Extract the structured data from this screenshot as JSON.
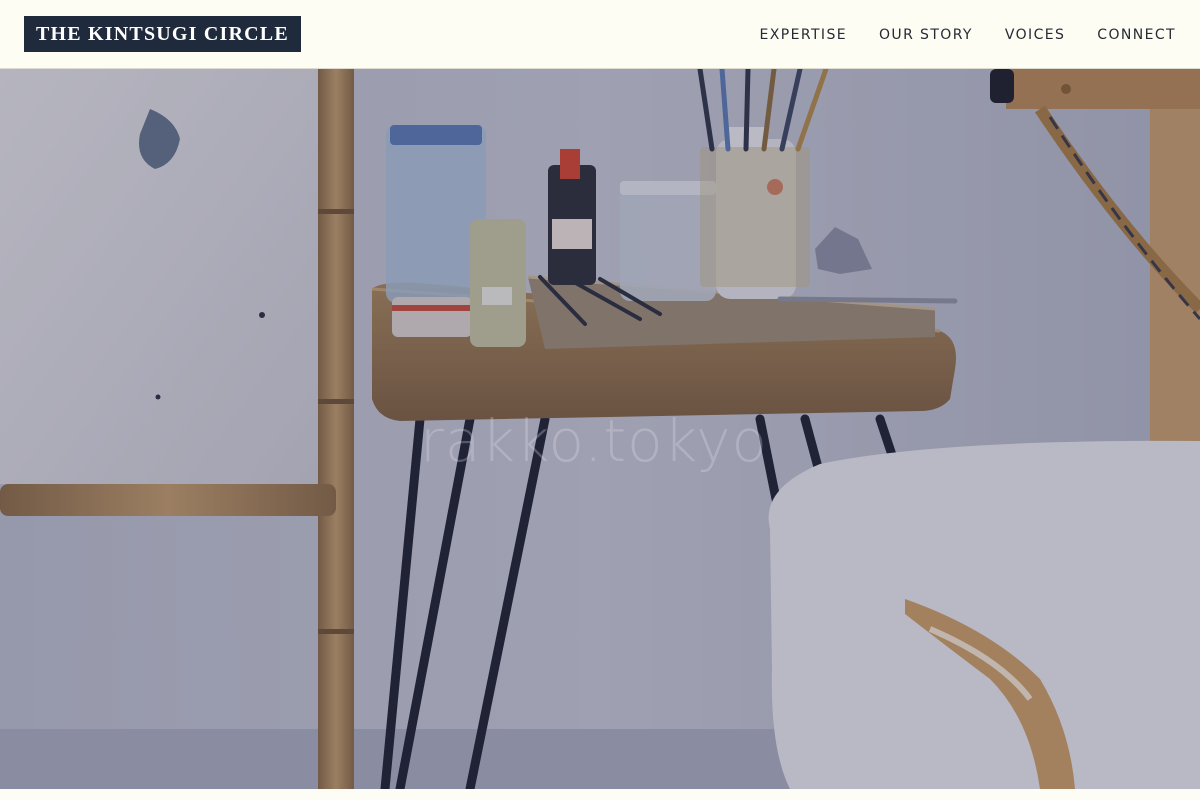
{
  "site": {
    "logo_text": "THE KINTSUGI CIRCLE"
  },
  "nav": {
    "items": [
      {
        "label": "EXPERTISE"
      },
      {
        "label": "OUR STORY"
      },
      {
        "label": "VOICES"
      },
      {
        "label": "CONNECT"
      }
    ]
  },
  "hero": {
    "watermark": "rakko.tokyo"
  },
  "colors": {
    "header_bg": "#fdfdf4",
    "logo_bg": "#1f2a3c",
    "logo_text": "#ffffff",
    "nav_text": "#262a35"
  }
}
